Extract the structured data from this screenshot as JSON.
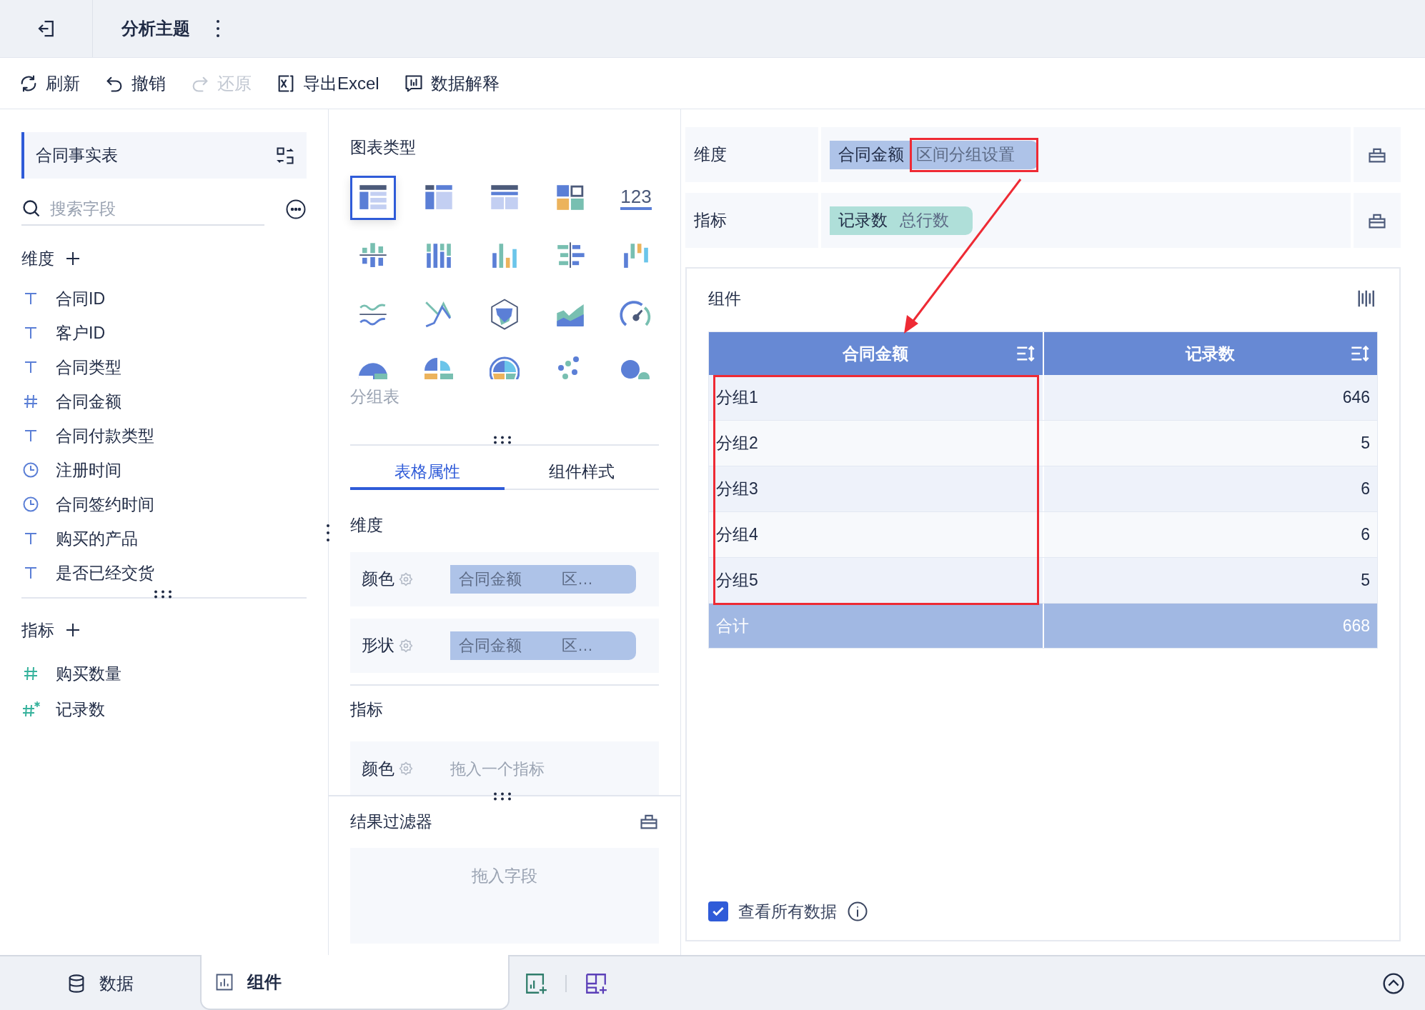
{
  "header": {
    "title": "分析主题"
  },
  "toolbar": [
    {
      "label": "刷新",
      "kind": "refresh",
      "disabled": false
    },
    {
      "label": "撤销",
      "kind": "undo",
      "disabled": false
    },
    {
      "label": "还原",
      "kind": "redo",
      "disabled": true
    },
    {
      "label": "导出Excel",
      "kind": "excel",
      "disabled": false
    },
    {
      "label": "数据解释",
      "kind": "explain",
      "disabled": false
    }
  ],
  "fields_panel": {
    "table_name": "合同事实表",
    "search": {
      "placeholder": "搜索字段"
    },
    "dimensions": {
      "title": "维度",
      "items": [
        {
          "name": "合同ID",
          "kind": "text"
        },
        {
          "name": "客户ID",
          "kind": "text"
        },
        {
          "name": "合同类型",
          "kind": "text"
        },
        {
          "name": "合同金额",
          "kind": "number"
        },
        {
          "name": "合同付款类型",
          "kind": "text"
        },
        {
          "name": "注册时间",
          "kind": "time"
        },
        {
          "name": "合同签约时间",
          "kind": "time"
        },
        {
          "name": "购买的产品",
          "kind": "text"
        },
        {
          "name": "是否已经交货",
          "kind": "text"
        }
      ]
    },
    "measures": {
      "title": "指标",
      "items": [
        {
          "name": "购买数量",
          "kind": "number"
        },
        {
          "name": "记录数",
          "kind": "count"
        }
      ]
    }
  },
  "chart_types": {
    "title": "图表类型",
    "options": [
      {
        "selected": true
      },
      {
        "selected": false
      },
      {
        "selected": false
      },
      {
        "selected": false
      },
      {
        "selected": false,
        "label": "123"
      },
      {
        "selected": false
      },
      {
        "selected": false
      },
      {
        "selected": false
      },
      {
        "selected": false
      },
      {
        "selected": false
      },
      {
        "selected": false
      },
      {
        "selected": false
      },
      {
        "selected": false
      },
      {
        "selected": false
      },
      {
        "selected": false
      },
      {
        "selected": false
      },
      {
        "selected": false
      },
      {
        "selected": false
      },
      {
        "selected": false
      },
      {
        "selected": false
      }
    ],
    "hint": "分组表"
  },
  "property_tabs": [
    {
      "label": "表格属性",
      "selected": true
    },
    {
      "label": "组件样式",
      "selected": false
    }
  ],
  "properties": {
    "dimension": {
      "title": "维度",
      "rows": [
        {
          "label": "颜色",
          "field": "合同金额",
          "extra": "区…"
        },
        {
          "label": "形状",
          "field": "合同金额",
          "extra": "区…"
        }
      ]
    },
    "measure": {
      "title": "指标",
      "rows": [
        {
          "label": "颜色",
          "drop_hint": "拖入一个指标"
        }
      ]
    }
  },
  "result_filter": {
    "title": "结果过滤器",
    "drop_hint": "拖入字段"
  },
  "shelves": [
    {
      "label": "维度",
      "kind": "dimension",
      "field": "合同金额",
      "extra": "区间分组设置",
      "highlighted": true
    },
    {
      "label": "指标",
      "kind": "measure",
      "field": "记录数",
      "extra": "总行数",
      "highlighted": false
    }
  ],
  "component": {
    "title": "组件",
    "table": {
      "columns": [
        "合同金额",
        "记录数"
      ],
      "rows": [
        [
          "分组1",
          "646"
        ],
        [
          "分组2",
          "5"
        ],
        [
          "分组3",
          "6"
        ],
        [
          "分组4",
          "6"
        ],
        [
          "分组5",
          "5"
        ]
      ],
      "total": [
        "合计",
        "668"
      ]
    },
    "show_all": {
      "label": "查看所有数据",
      "checked": true
    }
  },
  "bottom_tabs": [
    {
      "label": "数据",
      "kind": "data",
      "selected": false
    },
    {
      "label": "组件",
      "kind": "chart",
      "selected": true
    }
  ]
}
